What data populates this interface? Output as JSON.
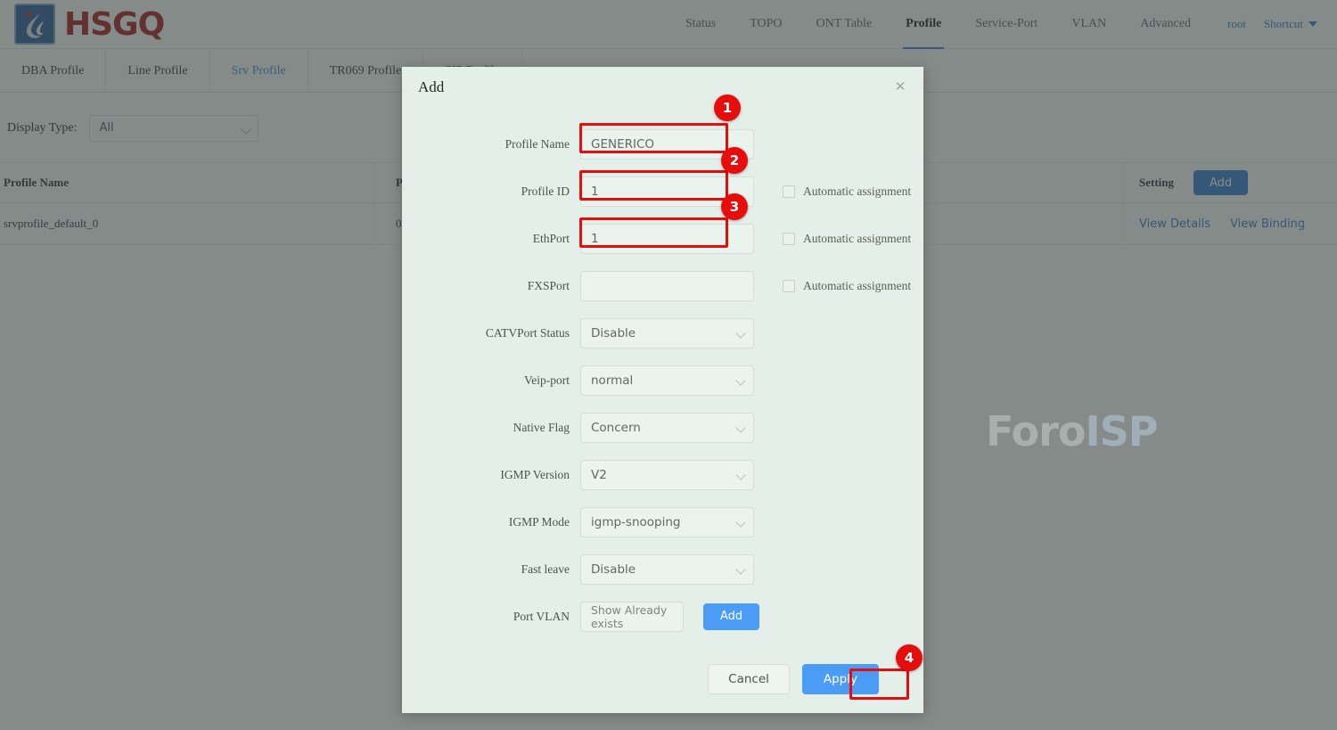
{
  "brand": {
    "name": "HSGQ",
    "logo_icon": "water-drop-logo-icon"
  },
  "topnav": {
    "items": [
      {
        "label": "Status",
        "active": false
      },
      {
        "label": "TOPO",
        "active": false
      },
      {
        "label": "ONT Table",
        "active": false
      },
      {
        "label": "Profile",
        "active": true
      },
      {
        "label": "Service-Port",
        "active": false
      },
      {
        "label": "VLAN",
        "active": false
      },
      {
        "label": "Advanced",
        "active": false
      }
    ],
    "user": "root",
    "shortcut": "Shortcut"
  },
  "tabs": [
    {
      "label": "DBA Profile",
      "active": false
    },
    {
      "label": "Line Profile",
      "active": false
    },
    {
      "label": "Srv Profile",
      "active": true
    },
    {
      "label": "TR069 Profile",
      "active": false
    },
    {
      "label": "SIP Profile",
      "active": false
    }
  ],
  "filter": {
    "label": "Display Type:",
    "value": "All"
  },
  "table": {
    "columns": [
      "Profile Name",
      "Profile",
      "Setting"
    ],
    "add_button": "Add",
    "rows": [
      {
        "profile_name": "srvprofile_default_0",
        "profile_id": "0",
        "actions": [
          "View Details",
          "View Binding"
        ]
      }
    ]
  },
  "modal": {
    "title": "Add",
    "close_icon": "close-icon",
    "fields": {
      "profile_name": {
        "label": "Profile Name",
        "value": "GENERICO"
      },
      "profile_id": {
        "label": "Profile ID",
        "value": "1",
        "auto": "Automatic assignment",
        "auto_checked": false
      },
      "eth_port": {
        "label": "EthPort",
        "value": "1",
        "auto": "Automatic assignment",
        "auto_checked": false
      },
      "fxs_port": {
        "label": "FXSPort",
        "value": "",
        "placeholder": "",
        "auto": "Automatic assignment",
        "auto_checked": false
      },
      "catv_port_status": {
        "label": "CATVPort Status",
        "value": "Disable"
      },
      "veip_port": {
        "label": "Veip-port",
        "value": "normal"
      },
      "native_flag": {
        "label": "Native Flag",
        "value": "Concern"
      },
      "igmp_version": {
        "label": "IGMP Version",
        "value": "V2"
      },
      "igmp_mode": {
        "label": "IGMP Mode",
        "value": "igmp-snooping"
      },
      "fast_leave": {
        "label": "Fast leave",
        "value": "Disable"
      },
      "port_vlan": {
        "label": "Port VLAN",
        "show_button": "Show Already exists",
        "add_button": "Add"
      }
    },
    "footer": {
      "cancel": "Cancel",
      "apply": "Apply"
    }
  },
  "watermark": {
    "part1": "Foro",
    "part2": "ISP"
  },
  "annotations": {
    "accent_color": "#e60d0d",
    "steps": [
      {
        "number": "1"
      },
      {
        "number": "2"
      },
      {
        "number": "3"
      },
      {
        "number": "4"
      }
    ]
  }
}
